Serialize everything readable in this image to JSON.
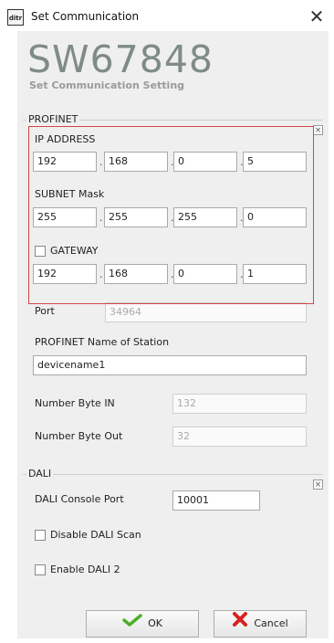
{
  "window": {
    "title": "Set Communication",
    "app_icon_text": "ditr",
    "close_icon": "close-icon"
  },
  "header": {
    "device": "SW67848",
    "subtitle": "Set Communication Setting"
  },
  "profinet": {
    "group_label": "PROFINET",
    "ip_label": "IP ADDRESS",
    "ip": [
      "192",
      "168",
      "0",
      "5"
    ],
    "subnet_label": "SUBNET Mask",
    "subnet": [
      "255",
      "255",
      "255",
      "0"
    ],
    "gateway_label": "GATEWAY",
    "gateway_checked": false,
    "gateway": [
      "192",
      "168",
      "0",
      "1"
    ],
    "port_label": "Port",
    "port": "34964",
    "name_label": "PROFINET Name of Station",
    "name": "devicename1",
    "byte_in_label": "Number Byte IN",
    "byte_in": "132",
    "byte_out_label": "Number Byte Out",
    "byte_out": "32"
  },
  "dali": {
    "group_label": "DALI",
    "console_port_label": "DALI Console Port",
    "console_port": "10001",
    "disable_scan_label": "Disable DALI Scan",
    "disable_scan_checked": false,
    "enable_dali2_label": "Enable DALI 2",
    "enable_dali2_checked": false
  },
  "buttons": {
    "ok": "OK",
    "cancel": "Cancel"
  },
  "colors": {
    "highlight": "#d04848",
    "title_gray": "#7f8b86"
  }
}
